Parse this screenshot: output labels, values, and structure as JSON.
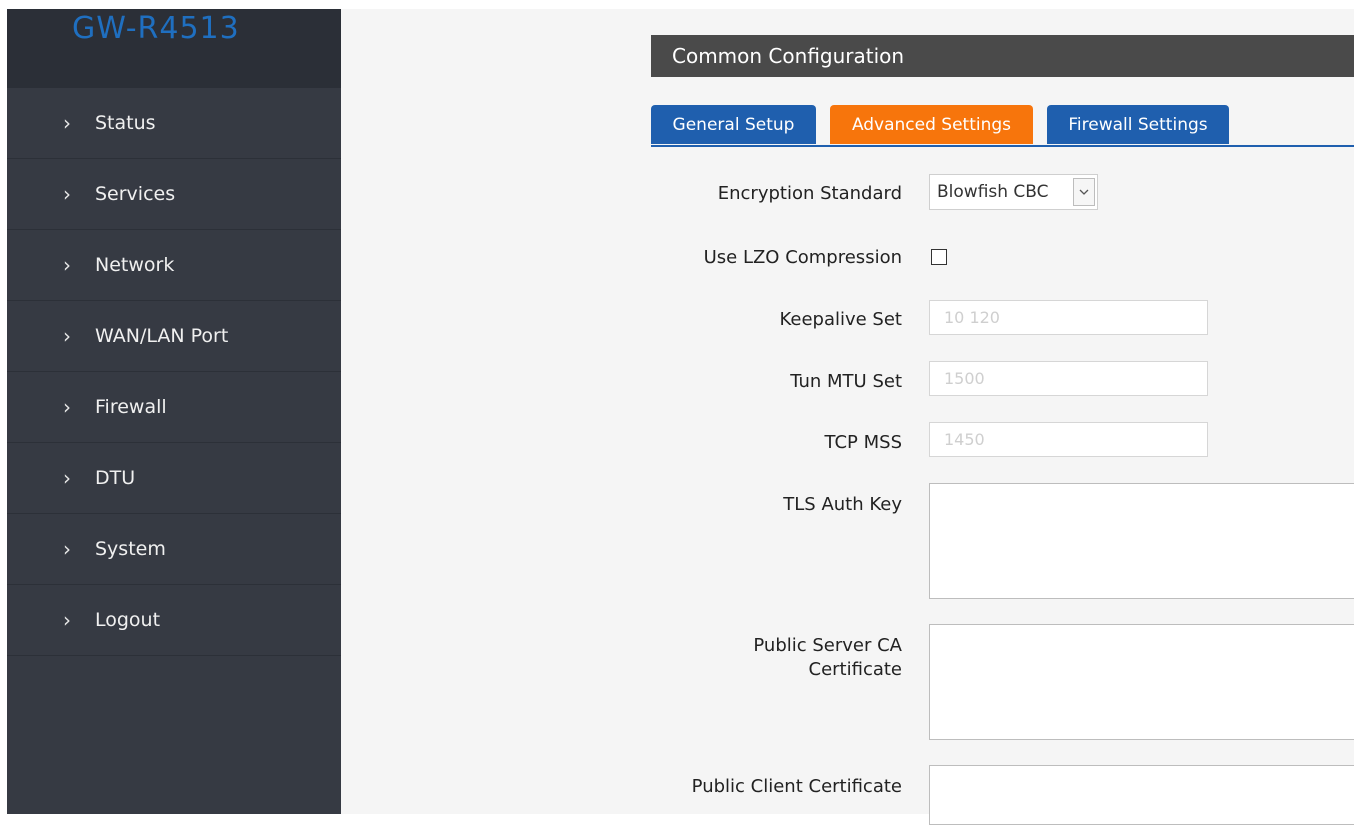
{
  "brand": "GW-R4513",
  "sidebar": {
    "items": [
      {
        "label": "Status"
      },
      {
        "label": "Services"
      },
      {
        "label": "Network"
      },
      {
        "label": "WAN/LAN Port"
      },
      {
        "label": "Firewall"
      },
      {
        "label": "DTU"
      },
      {
        "label": "System"
      },
      {
        "label": "Logout"
      }
    ],
    "chevron": "›"
  },
  "section": {
    "title": "Common Configuration"
  },
  "tabs": [
    {
      "label": "General Setup",
      "active": false
    },
    {
      "label": "Advanced Settings",
      "active": true
    },
    {
      "label": "Firewall Settings",
      "active": false
    }
  ],
  "form": {
    "encryption": {
      "label": "Encryption Standard",
      "value": "Blowfish CBC"
    },
    "lzo": {
      "label": "Use LZO Compression",
      "checked": false
    },
    "keepalive": {
      "label": "Keepalive Set",
      "placeholder": "10 120"
    },
    "tun_mtu": {
      "label": "Tun MTU Set",
      "placeholder": "1500"
    },
    "tcp_mss": {
      "label": "TCP MSS",
      "placeholder": "1450"
    },
    "tls_auth": {
      "label": "TLS Auth Key"
    },
    "server_ca": {
      "label_line1": "Public Server CA",
      "label_line2": "Certificate"
    },
    "client_cert": {
      "label": "Public Client Certificate"
    }
  },
  "colors": {
    "sidebar": "#363a43",
    "brand": "#1f6fc0",
    "tab_blue": "#1f5fae",
    "tab_active": "#f7750c",
    "header": "#4a4a4a"
  }
}
